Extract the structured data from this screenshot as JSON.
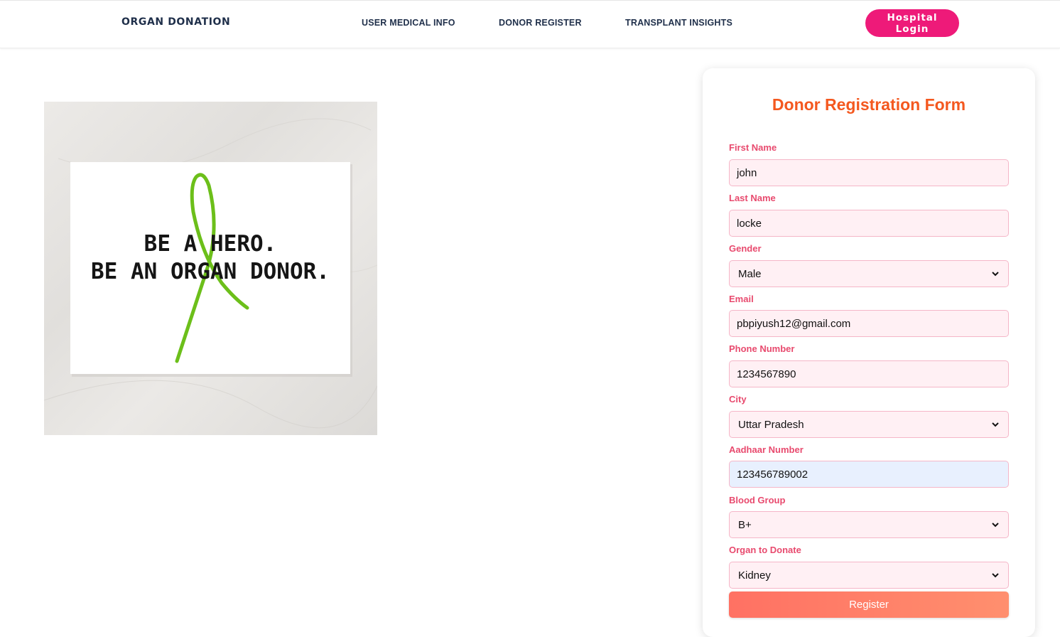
{
  "nav": {
    "brand": "ORGAN DONATION",
    "links": [
      "USER MEDICAL INFO",
      "DONOR REGISTER",
      "TRANSPLANT INSIGHTS"
    ],
    "login_button": "Hospital Login"
  },
  "hero": {
    "line1": "BE A HERO.",
    "line2": "BE AN ORGAN DONOR.",
    "ribbon_color": "#6cbf1a"
  },
  "form": {
    "title": "Donor Registration Form",
    "fields": {
      "first_name": {
        "label": "First Name",
        "value": "john"
      },
      "last_name": {
        "label": "Last Name",
        "value": "locke"
      },
      "gender": {
        "label": "Gender",
        "value": "Male"
      },
      "email": {
        "label": "Email",
        "value": "pbpiyush12@gmail.com"
      },
      "phone": {
        "label": "Phone Number",
        "value": "1234567890"
      },
      "city": {
        "label": "City",
        "value": "Uttar Pradesh"
      },
      "aadhaar": {
        "label": "Aadhaar Number",
        "value": "123456789002"
      },
      "blood_group": {
        "label": "Blood Group",
        "value": "B+"
      },
      "organ": {
        "label": "Organ to Donate",
        "value": "Kidney"
      }
    },
    "submit_label": "Register"
  },
  "colors": {
    "title": "#f4581f",
    "label": "#e84a6e",
    "login_button": "#ee1a79",
    "input_bg": "#fff0f4",
    "input_border": "#f5b6c8",
    "autofill_bg": "#e8f0fe",
    "register_gradient_start": "#ff7163",
    "register_gradient_end": "#ff8f6e"
  }
}
